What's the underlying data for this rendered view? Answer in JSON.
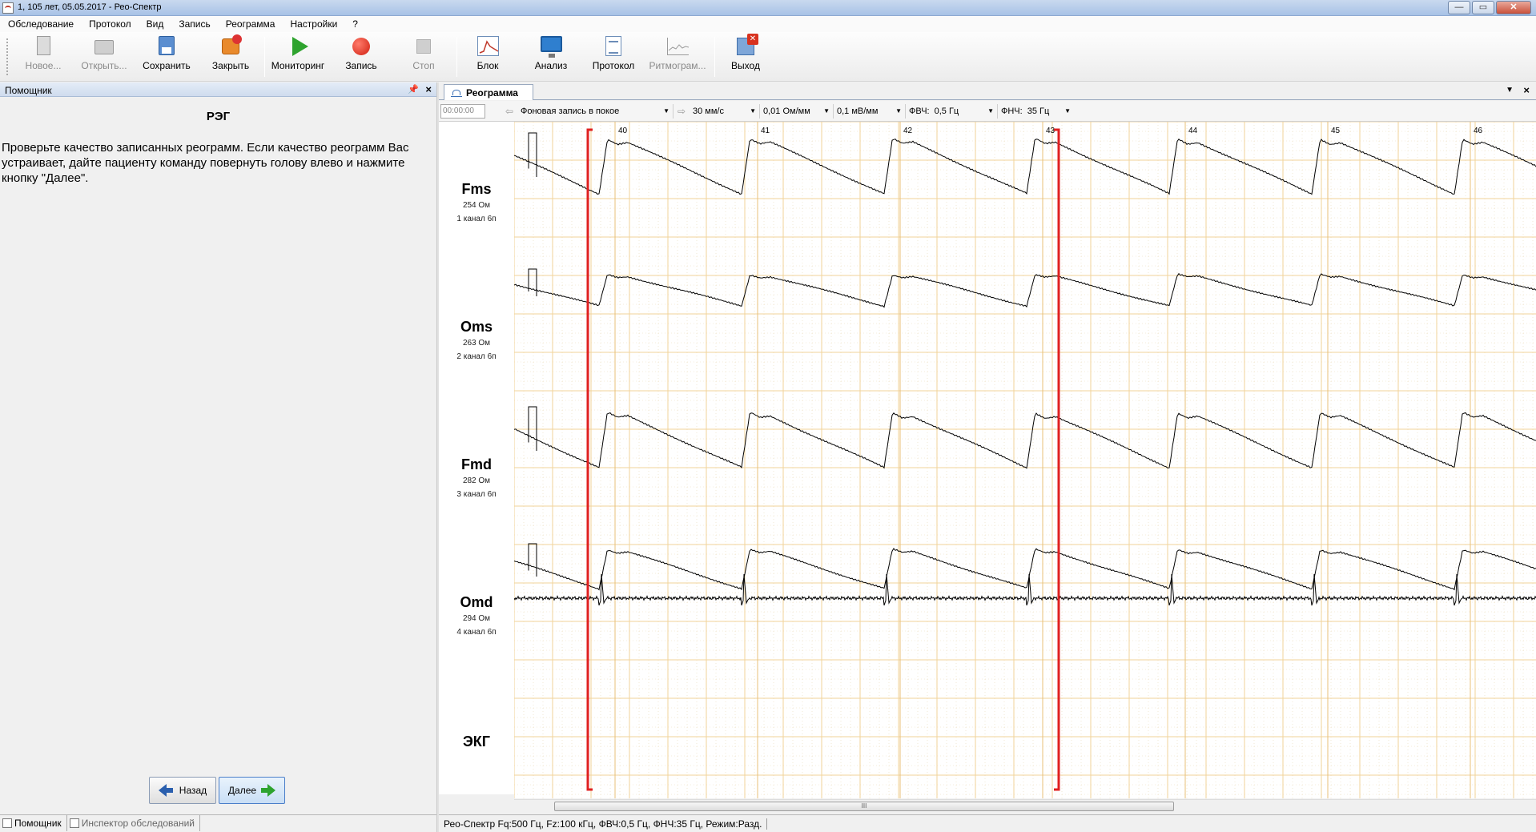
{
  "window": {
    "title": "1, 105 лет, 05.05.2017 - Рео-Спектр"
  },
  "menu": [
    "Обследование",
    "Протокол",
    "Вид",
    "Запись",
    "Реограмма",
    "Настройки",
    "?"
  ],
  "toolbar": {
    "new": "Новое...",
    "open": "Открыть...",
    "save": "Сохранить",
    "close": "Закрыть",
    "monitoring": "Мониторинг",
    "record": "Запись",
    "stop": "Стоп",
    "block": "Блок",
    "analysis": "Анализ",
    "protocol": "Протокол",
    "rhythmogram": "Ритмограм...",
    "exit": "Выход"
  },
  "assistant": {
    "panel_title": "Помощник",
    "heading": "РЭГ",
    "text": "Проверьте качество записанных реограмм. Если качество реограмм Вас устраивает, дайте пациенту команду повернуть голову влево и нажмите кнопку \"Далее\".",
    "back_label": "Назад",
    "next_label": "Далее"
  },
  "left_tabs": [
    "Помощник",
    "Инспектор обследований"
  ],
  "document": {
    "tab_label": "Реограмма"
  },
  "graph_toolbar": {
    "time": "00:00:00",
    "mode": "Фоновая запись в покое",
    "speed": "30 мм/с",
    "gain_reo": "0,01 Ом/мм",
    "gain_ecg": "0,1 мВ/мм",
    "hpf_label": "ФВЧ:",
    "hpf": "0,5 Гц",
    "lpf_label": "ФНЧ:",
    "lpf": "35 Гц"
  },
  "channels": [
    {
      "name": "Fms",
      "impedance": "254 Ом",
      "channel": "1 канал 6п"
    },
    {
      "name": "Oms",
      "impedance": "263 Ом",
      "channel": "2 канал 6п"
    },
    {
      "name": "Fmd",
      "impedance": "282 Ом",
      "channel": "3 канал 6п"
    },
    {
      "name": "Omd",
      "impedance": "294 Ом",
      "channel": "4 канал 6п"
    },
    {
      "name": "ЭКГ",
      "impedance": "",
      "channel": ""
    }
  ],
  "time_markers": [
    "40",
    "41",
    "42",
    "43",
    "44",
    "45",
    "46"
  ],
  "selection": {
    "start_marker": "40",
    "end_marker": "43"
  },
  "scroll_thumb": "III",
  "status": "Рео-Спектр Fq:500 Гц, Fz:100 кГц, ФВЧ:0,5 Гц, ФНЧ:35 Гц, Режим:Разд.",
  "colors": {
    "grid_major": "#f2d39a",
    "grid_minor": "#e9d9b8",
    "trace": "#000000",
    "selection": "#e02020",
    "accent": "#3a6fb5"
  }
}
